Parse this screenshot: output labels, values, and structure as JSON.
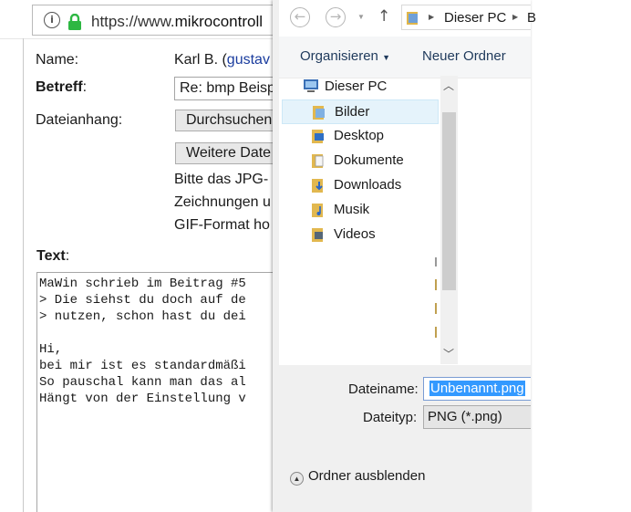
{
  "browser": {
    "url_prefix": "https://www.",
    "url_domain": "mikrocontroll"
  },
  "form": {
    "name_label": "Name:",
    "name_value": "Karl B. (",
    "name_link": "gustav",
    "subject_label": "Betreff",
    "subject_colon": ":",
    "subject_value": "Re: bmp Beisp",
    "attachment_label": "Dateianhang:",
    "browse_button": "Durchsuchen",
    "more_files_button": "Weitere Date",
    "note_lines": [
      "Bitte das JPG-",
      "Zeichnungen u",
      "GIF-Format ho"
    ],
    "text_label": "Text",
    "text_colon": ":",
    "text_body": "MaWin schrieb im Beitrag #5\n> Die siehst du doch auf de\n> nutzen, schon hast du dei\n\nHi,\nbei mir ist es standardmäßi\nSo pauschal kann man das al\nHängt von der Einstellung v"
  },
  "dialog": {
    "back_icon": "arrow-left-icon",
    "forward_icon": "arrow-right-icon",
    "up_icon": "arrow-up-icon",
    "breadcrumb_root": "Dieser PC",
    "breadcrumb_next": "B",
    "organize_label": "Organisieren",
    "new_folder_label": "Neuer Ordner",
    "tree": [
      {
        "label": "Dieser PC",
        "icon": "computer-icon"
      },
      {
        "label": "Bilder",
        "icon": "pictures-folder-icon"
      },
      {
        "label": "Desktop",
        "icon": "desktop-folder-icon"
      },
      {
        "label": "Dokumente",
        "icon": "documents-folder-icon"
      },
      {
        "label": "Downloads",
        "icon": "downloads-folder-icon"
      },
      {
        "label": "Musik",
        "icon": "music-folder-icon"
      },
      {
        "label": "Videos",
        "icon": "videos-folder-icon"
      }
    ],
    "filename_label": "Dateiname:",
    "filename_value": "Unbenannt.png",
    "filetype_label": "Dateityp:",
    "filetype_value": "PNG (*.png)",
    "hide_folders_label": "Ordner ausblenden"
  },
  "colors": {
    "selection": "#3399ff",
    "tree_selected": "#e5f3fb",
    "link": "#1a3c9e",
    "toolbar_text": "#1e395b"
  }
}
